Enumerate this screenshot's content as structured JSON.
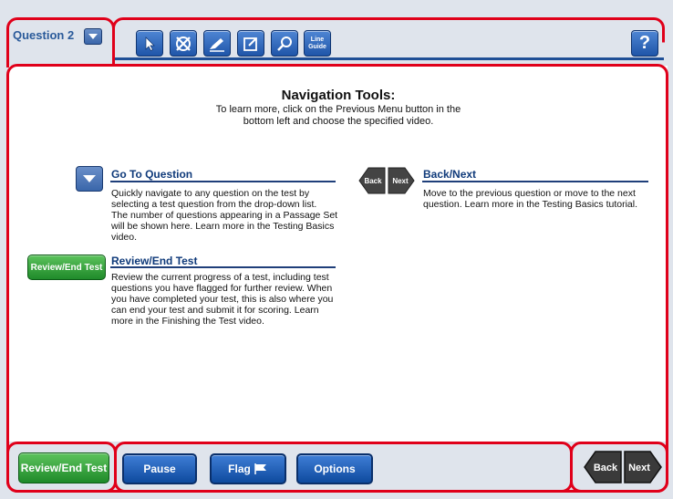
{
  "header": {
    "question_label": "Question 2",
    "tools": [
      {
        "name": "pointer-icon"
      },
      {
        "name": "eliminator-icon"
      },
      {
        "name": "highlighter-icon"
      },
      {
        "name": "notepad-icon"
      },
      {
        "name": "magnifier-icon"
      },
      {
        "name": "line-guide-icon",
        "label": "Line Guide"
      }
    ],
    "help_label": "?"
  },
  "main": {
    "title": "Navigation Tools:",
    "subtitle": "To learn more, click on the Previous Menu button in the\nbottom left and choose the specified video.",
    "sections": {
      "go_to_question": {
        "title": "Go To Question",
        "text": "Quickly navigate to any question on the test by\nselecting a test question from the drop-down list.\nThe number of questions appearing in a Passage Set\nwill be shown here. Learn more in the Testing Basics\nvideo."
      },
      "review_end": {
        "title": "Review/End Test",
        "button_label": "Review/End Test",
        "text": "Review the current progress of a test, including test\nquestions you have flagged for further review. When\nyou have completed your test, this is also where you\ncan end your test and submit it for scoring. Learn\nmore in the Finishing the Test video."
      },
      "back_next": {
        "title": "Back/Next",
        "back_label": "Back",
        "next_label": "Next",
        "text": "Move to the previous question or move to the next\nquestion. Learn more in the Testing Basics tutorial."
      }
    }
  },
  "footer": {
    "review_end_label": "Review/End Test",
    "pause_label": "Pause",
    "flag_label": "Flag",
    "options_label": "Options",
    "back_label": "Back",
    "next_label": "Next"
  },
  "colors": {
    "highlight_frame": "#e0001a",
    "accent_blue": "#1f4f96",
    "green_button": "#1f8a2a"
  }
}
